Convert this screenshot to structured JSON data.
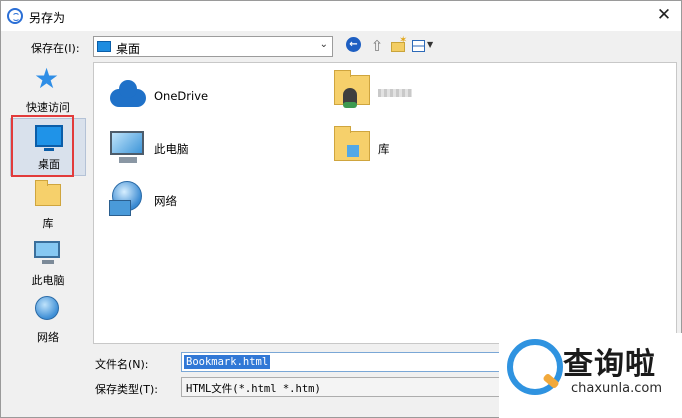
{
  "window": {
    "title": "另存为"
  },
  "toolbar": {
    "save_in_label": "保存在(I):",
    "location_value": "桌面"
  },
  "nav": {
    "items": [
      {
        "label": "快速访问",
        "icon": "star-icon"
      },
      {
        "label": "桌面",
        "icon": "desktop-icon",
        "selected": true
      },
      {
        "label": "库",
        "icon": "folder-icon"
      },
      {
        "label": "此电脑",
        "icon": "computer-icon"
      },
      {
        "label": "网络",
        "icon": "network-icon"
      }
    ]
  },
  "files": {
    "items": [
      {
        "label": "OneDrive",
        "icon": "onedrive-cloud-icon"
      },
      {
        "label": "",
        "icon": "user-folder-icon"
      },
      {
        "label": "此电脑",
        "icon": "computer-icon"
      },
      {
        "label": "库",
        "icon": "library-folder-icon"
      },
      {
        "label": "网络",
        "icon": "network-icon"
      }
    ]
  },
  "form": {
    "filename_label": "文件名(N):",
    "filename_value": "Bookmark.html",
    "filetype_label": "保存类型(T):",
    "filetype_value": "HTML文件(*.html *.htm)"
  },
  "watermark": {
    "name": "查询啦",
    "url": "chaxunla.com"
  },
  "colors": {
    "accent": "#2f93e0",
    "highlight": "#e23b3b",
    "selection": "#3178d6"
  }
}
